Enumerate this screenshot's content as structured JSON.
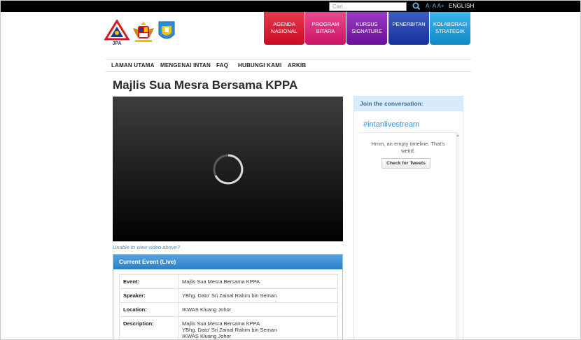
{
  "topbar": {
    "search_placeholder": "Cari...",
    "font_controls": "A- A A+",
    "language": "ENGLISH"
  },
  "tiles": [
    {
      "line1": "AGENDA",
      "line2": "NASIONAL",
      "color": "#d7102b"
    },
    {
      "line1": "PROGRAM",
      "line2": "BITARA",
      "color": "#d81a73"
    },
    {
      "line1": "KURSUS",
      "line2": "SIGNATURE",
      "color": "#7a17a8"
    },
    {
      "line1": "PENERBITAN",
      "line2": "",
      "color": "#1f3fa8"
    },
    {
      "line1": "KOLABORASI",
      "line2": "STRATEGIK",
      "color": "#1a9bd6"
    }
  ],
  "logos": {
    "jpa_text": "JPA"
  },
  "nav": [
    "LAMAN UTAMA",
    "MENGENAI INTAN",
    "FAQ",
    "HUBUNGI KAMI",
    "ARKIB"
  ],
  "page_title": "Majlis Sua Mesra Bersama KPPA",
  "video_link": "Unable to view video above?",
  "event": {
    "heading": "Current Event (Live)",
    "rows": [
      {
        "label": "Event:",
        "value": "Majlis Sua Mesra Bersama KPPA"
      },
      {
        "label": "Speaker:",
        "value": "YBhg. Dato' Sri Zainal Rahim bin Seman"
      },
      {
        "label": "Location:",
        "value": "IKWAS Kluang Johor"
      },
      {
        "label": "Description:",
        "value_lines": [
          "Majlis Sua Mesra Bersama KPPA",
          "YBhg. Dato' Sri Zainal Rahim bin Seman",
          "IKWAS Kluang Johor"
        ]
      }
    ]
  },
  "sidebar": {
    "heading": "Join the conversation:",
    "hashtag": "#intanlivestream",
    "empty_message": "Hmm, an empty timeline. That's weird.",
    "check_button": "Check for Tweets"
  }
}
